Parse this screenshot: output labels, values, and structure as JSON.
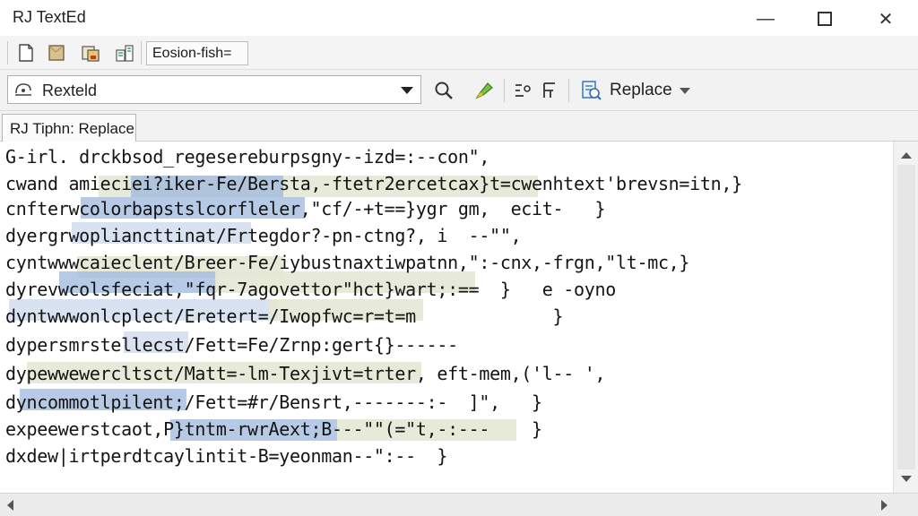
{
  "window": {
    "title": "RJ TextEd",
    "minimize_glyph": "—",
    "close_glyph": "✕"
  },
  "toolbar1": {
    "icons": [
      "new-file-icon",
      "open-file-icon",
      "save-file-icon",
      "compare-files-icon"
    ],
    "combo_value": "Eosion-fish="
  },
  "toolbar2": {
    "search_combo_value": "Rexteld",
    "icons": [
      "find-icon",
      "highlight-icon",
      "find-options-icon",
      "replace-mode-icon"
    ],
    "replace_label": "Replace"
  },
  "tabs": [
    {
      "label": "RJ Tiphn: Replace"
    }
  ],
  "editor": {
    "lines": [
      "G-irl. drckbsod_regesereburpsgny--izd=:--con\",",
      "cwand amieciei?iker-Fe/Bersta,-ftetr2ercetcax}t=cwenhtext'brevsn=itn,}",
      "cnfterwcolorbapstslcorfleler,\"cf/-+t==}ygr gm,  ecit-   }",
      "dyergrwopliancttinat/Frtegdor?-pn-ctng?, i  --\"\",",
      "cyntwwwcaieclent/Breer-Fe/iybustnaxtiwpatnn,\":-cnx,-frgn,\"lt-mc,}",
      "dyrevwcolsfeciat,\"fqr-7agovettor\"hct}wart;:==  }   e -oyno",
      "dyntwwwonlcplect/Eretert=/Iwopfwc=r=t=m             }",
      "dypersmrstellecst/Fett=Fe/Zrnp:gert{}------",
      "dypewwewercltsct/Matt=-lm-Texjivt=trter, eft-mem,('l-- ',",
      "dyncommotlpilent;/Fett=#r/Bensrt,-------:-  ]\",   }",
      "expeewerstcaot,P}tntm-rwrAext;B---\"\"(=\"t,-:---    }",
      "dxdew|irtperdtcaylintit-B=yeonman--\":--  }"
    ]
  }
}
